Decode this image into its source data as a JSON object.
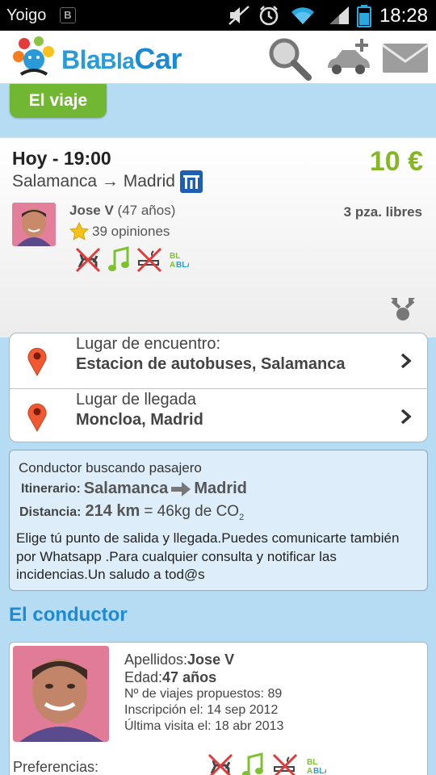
{
  "status_bar": {
    "carrier": "Yoigo",
    "bbm_label": "B",
    "time": "18:28",
    "icons": [
      "muted-speaker-icon",
      "alarm-clock-icon",
      "wifi-icon",
      "signal-icon",
      "battery-icon"
    ]
  },
  "header": {
    "logo_part1": "Bla",
    "logo_part2": "Bla",
    "logo_part3": "Car",
    "icons": [
      "search-icon",
      "offer-ride-icon",
      "messages-icon"
    ]
  },
  "tab": {
    "label": "El viaje"
  },
  "trip": {
    "when": "Hoy - 19:00",
    "route": "Salamanca → Madrid",
    "price": "10 €",
    "driver_name": "Jose V",
    "driver_age": "(47 años)",
    "reviews": "39 opiniones",
    "seats": "3 pza. libres",
    "pref_bla": "BLA"
  },
  "locations": {
    "meeting_label": "Lugar de encuentro:",
    "meeting_value": "Estacion de autobuses, Salamanca",
    "arrival_label": "Lugar de llegada",
    "arrival_value": "Moncloa, Madrid"
  },
  "description": {
    "status": "Conductor buscando pasajero",
    "itinerary_label": "Itinerario:",
    "itinerary_from": "Salamanca",
    "itinerary_to": "Madrid",
    "distance_label": "Distancia:",
    "distance_value": "214 km",
    "co2": "= 46kg de CO",
    "co2_sub": "2",
    "message": "Elige tú punto de salida y llegada.Puedes comunicarte también por Whatsapp .Para cualquier consulta y notificar las incidencias.Un saludo a tod@s"
  },
  "conductor": {
    "section_title": "El conductor",
    "apellidos_label": "Apellidos:",
    "apellidos_value": "Jose V",
    "edad_label": "Edad:",
    "edad_value": "47 años",
    "viajes": "Nº de viajes propuestos: 89",
    "inscripcion": "Inscripción el: 14 sep 2012",
    "ultima_visita": "Última visita el: 18 abr 2013",
    "preferencias_label": "Preferencias:"
  },
  "colors": {
    "brand_blue": "#2a9bd8",
    "tab_green": "#72b733",
    "price_green": "#86b625",
    "background": "#b6dcf3"
  }
}
